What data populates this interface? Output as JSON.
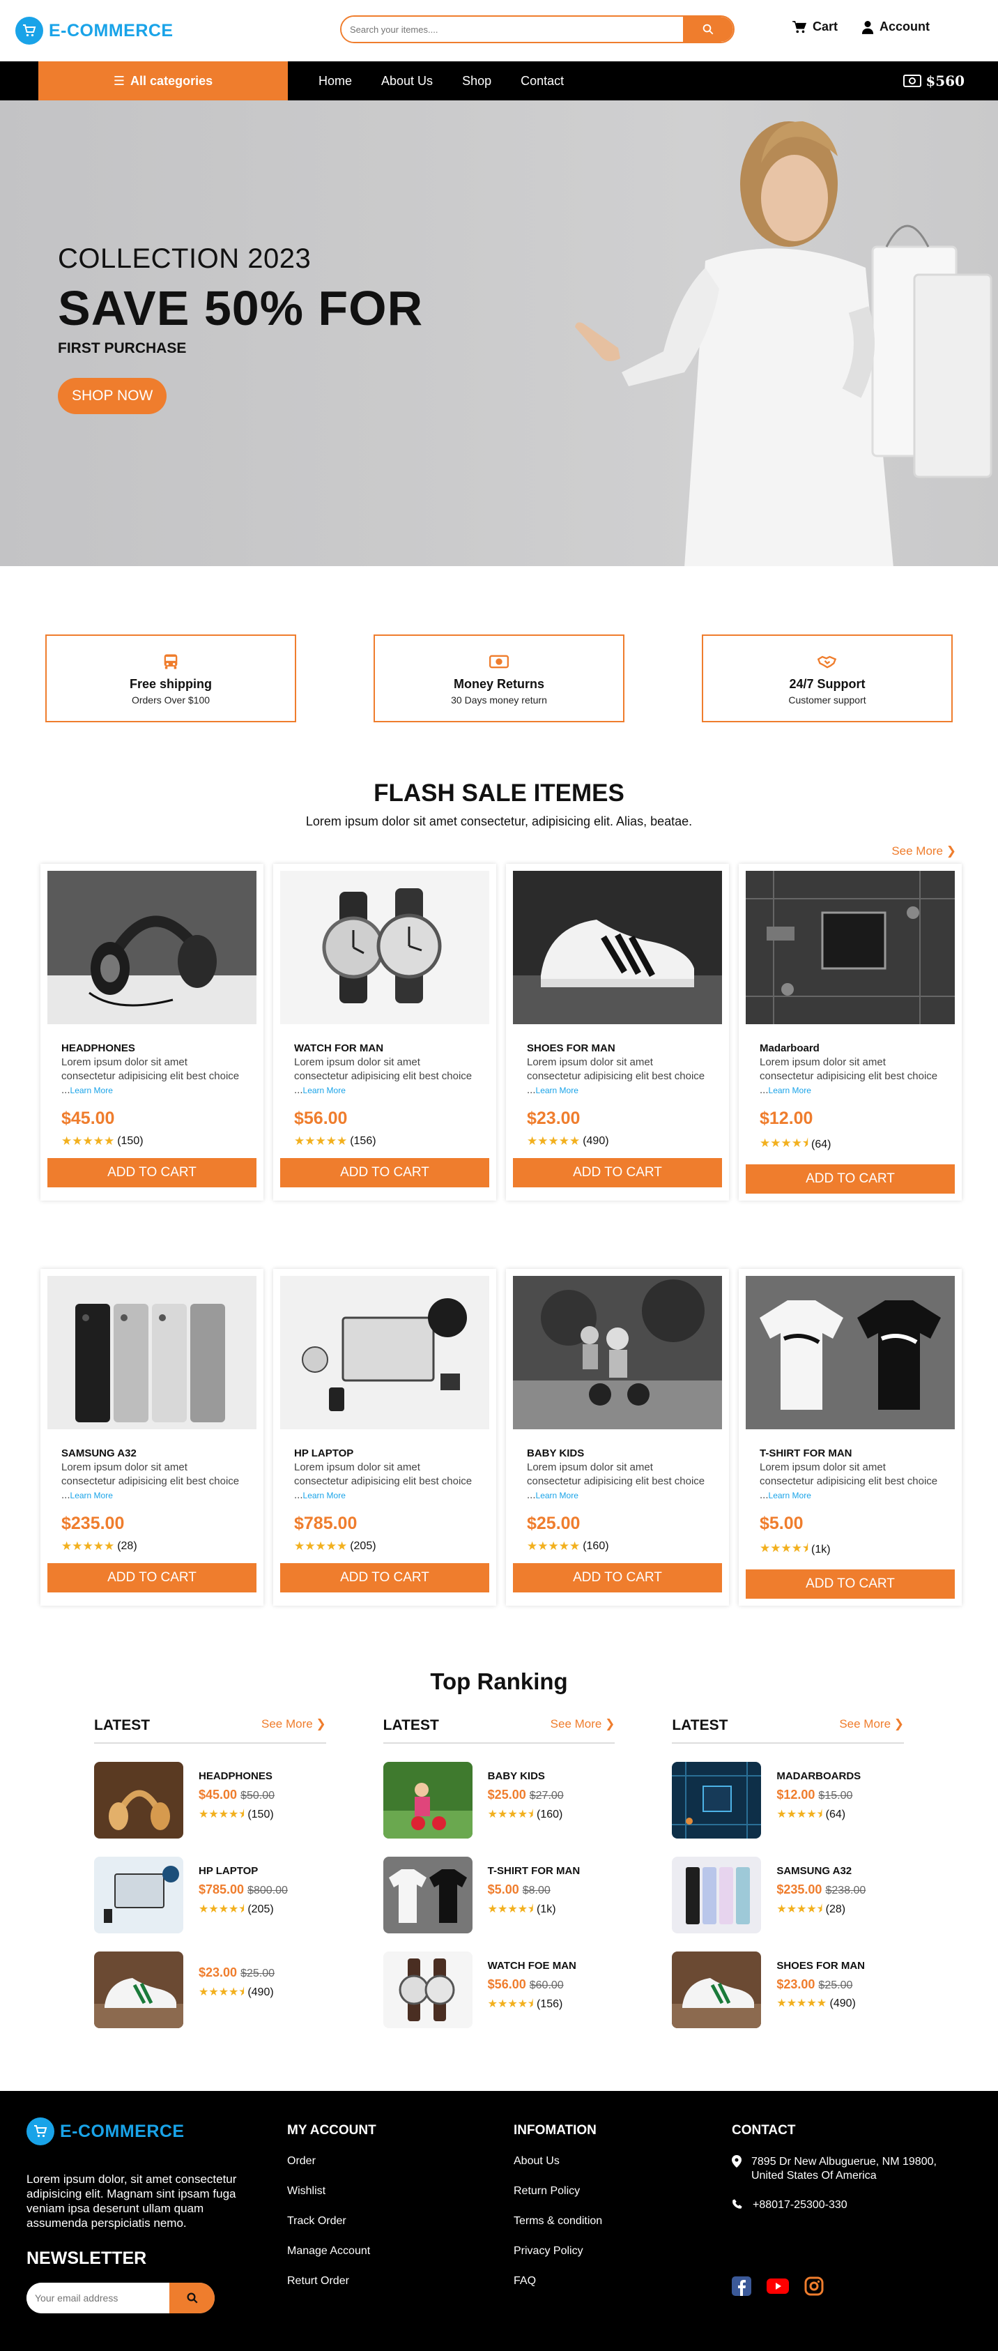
{
  "header": {
    "logo_text": "E-COMMERCE",
    "search_placeholder": "Search your itemes....",
    "cart_label": "Cart",
    "account_label": "Account"
  },
  "nav": {
    "categories_label": "All categories",
    "links": [
      "Home",
      "About Us",
      "Shop",
      "Contact"
    ],
    "balance": "$560"
  },
  "hero": {
    "subtitle": "COLLECTION 2023",
    "title": "SAVE 50% FOR",
    "small": "FIRST PURCHASE",
    "button": "SHOP NOW"
  },
  "services": [
    {
      "title": "Free shipping",
      "sub": "Orders Over $100",
      "icon": "bus-icon"
    },
    {
      "title": "Money Returns",
      "sub": "30 Days money return",
      "icon": "money-icon"
    },
    {
      "title": "24/7 Support",
      "sub": "Customer support",
      "icon": "handshake-icon"
    }
  ],
  "flash": {
    "title": "FLASH SALE ITEMES",
    "desc": "Lorem ipsum dolor sit amet consectetur, adipisicing elit. Alias, beatae.",
    "see_more": "See More"
  },
  "product_desc": "Lorem ipsum dolor sit amet consectetur adipisicing elit best choice ...",
  "learn_more": "Learn More",
  "add_to_cart": "ADD TO CART",
  "products": [
    {
      "name": "HEADPHONES",
      "price": "$45.00",
      "count": "(150)",
      "rating": 5
    },
    {
      "name": "WATCH FOR MAN",
      "price": "$56.00",
      "count": "(156)",
      "rating": 5
    },
    {
      "name": "SHOES FOR MAN",
      "price": "$23.00",
      "count": "(490)",
      "rating": 5
    },
    {
      "name": "Madarboard",
      "price": "$12.00",
      "count": "(64)",
      "rating": 4.5
    },
    {
      "name": "SAMSUNG A32",
      "price": "$235.00",
      "count": "(28)",
      "rating": 5
    },
    {
      "name": "HP LAPTOP",
      "price": "$785.00",
      "count": "(205)",
      "rating": 5
    },
    {
      "name": "BABY KIDS",
      "price": "$25.00",
      "count": "(160)",
      "rating": 5
    },
    {
      "name": "T-SHIRT FOR MAN",
      "price": "$5.00",
      "count": "(1k)",
      "rating": 4.5
    }
  ],
  "ranking": {
    "title": "Top Ranking",
    "col_title": "LATEST",
    "see_more": "See More",
    "columns": [
      [
        {
          "name": "HEADPHONES",
          "price": "$45.00",
          "old": "$50.00",
          "count": "(150)"
        },
        {
          "name": "HP LAPTOP",
          "price": "$785.00",
          "old": "$800.00",
          "count": "(205)"
        },
        {
          "name": "",
          "price": "$23.00",
          "old": "$25.00",
          "count": "(490)"
        }
      ],
      [
        {
          "name": "BABY KIDS",
          "price": "$25.00",
          "old": "$27.00",
          "count": "(160)"
        },
        {
          "name": "T-SHIRT FOR MAN",
          "price": "$5.00",
          "old": "$8.00",
          "count": "(1k)"
        },
        {
          "name": "WATCH FOE MAN",
          "price": "$56.00",
          "old": "$60.00",
          "count": "(156)"
        }
      ],
      [
        {
          "name": "MADARBOARDS",
          "price": "$12.00",
          "old": "$15.00",
          "count": "(64)"
        },
        {
          "name": "SAMSUNG A32",
          "price": "$235.00",
          "old": "$238.00",
          "count": "(28)"
        },
        {
          "name": "SHOES FOR MAN",
          "price": "$23.00",
          "old": "$25.00",
          "count": "(490)"
        }
      ]
    ]
  },
  "footer": {
    "logo_text": "E-COMMERCE",
    "about": "Lorem ipsum dolor, sit amet consectetur adipisicing elit. Magnam sint ipsam fuga veniam ipsa deserunt ullam quam assumenda perspiciatis nemo.",
    "newsletter_title": "NEWSLETTER",
    "email_placeholder": "Your email address",
    "account_title": "MY ACCOUNT",
    "account_links": [
      "Order",
      "Wishlist",
      "Track Order",
      "Manage Account",
      "Returt Order"
    ],
    "info_title": "INFOMATION",
    "info_links": [
      "About Us",
      "Return Policy",
      "Terms & condition",
      "Privacy Policy",
      "FAQ"
    ],
    "contact_title": "CONTACT",
    "address": "7895 Dr New Albuguerue, NM 19800, United States Of America",
    "phone": "+88017-25300-330"
  },
  "colors": {
    "accent": "#ef7d2d",
    "brand": "#19a3e8",
    "star": "#f2b01e"
  }
}
